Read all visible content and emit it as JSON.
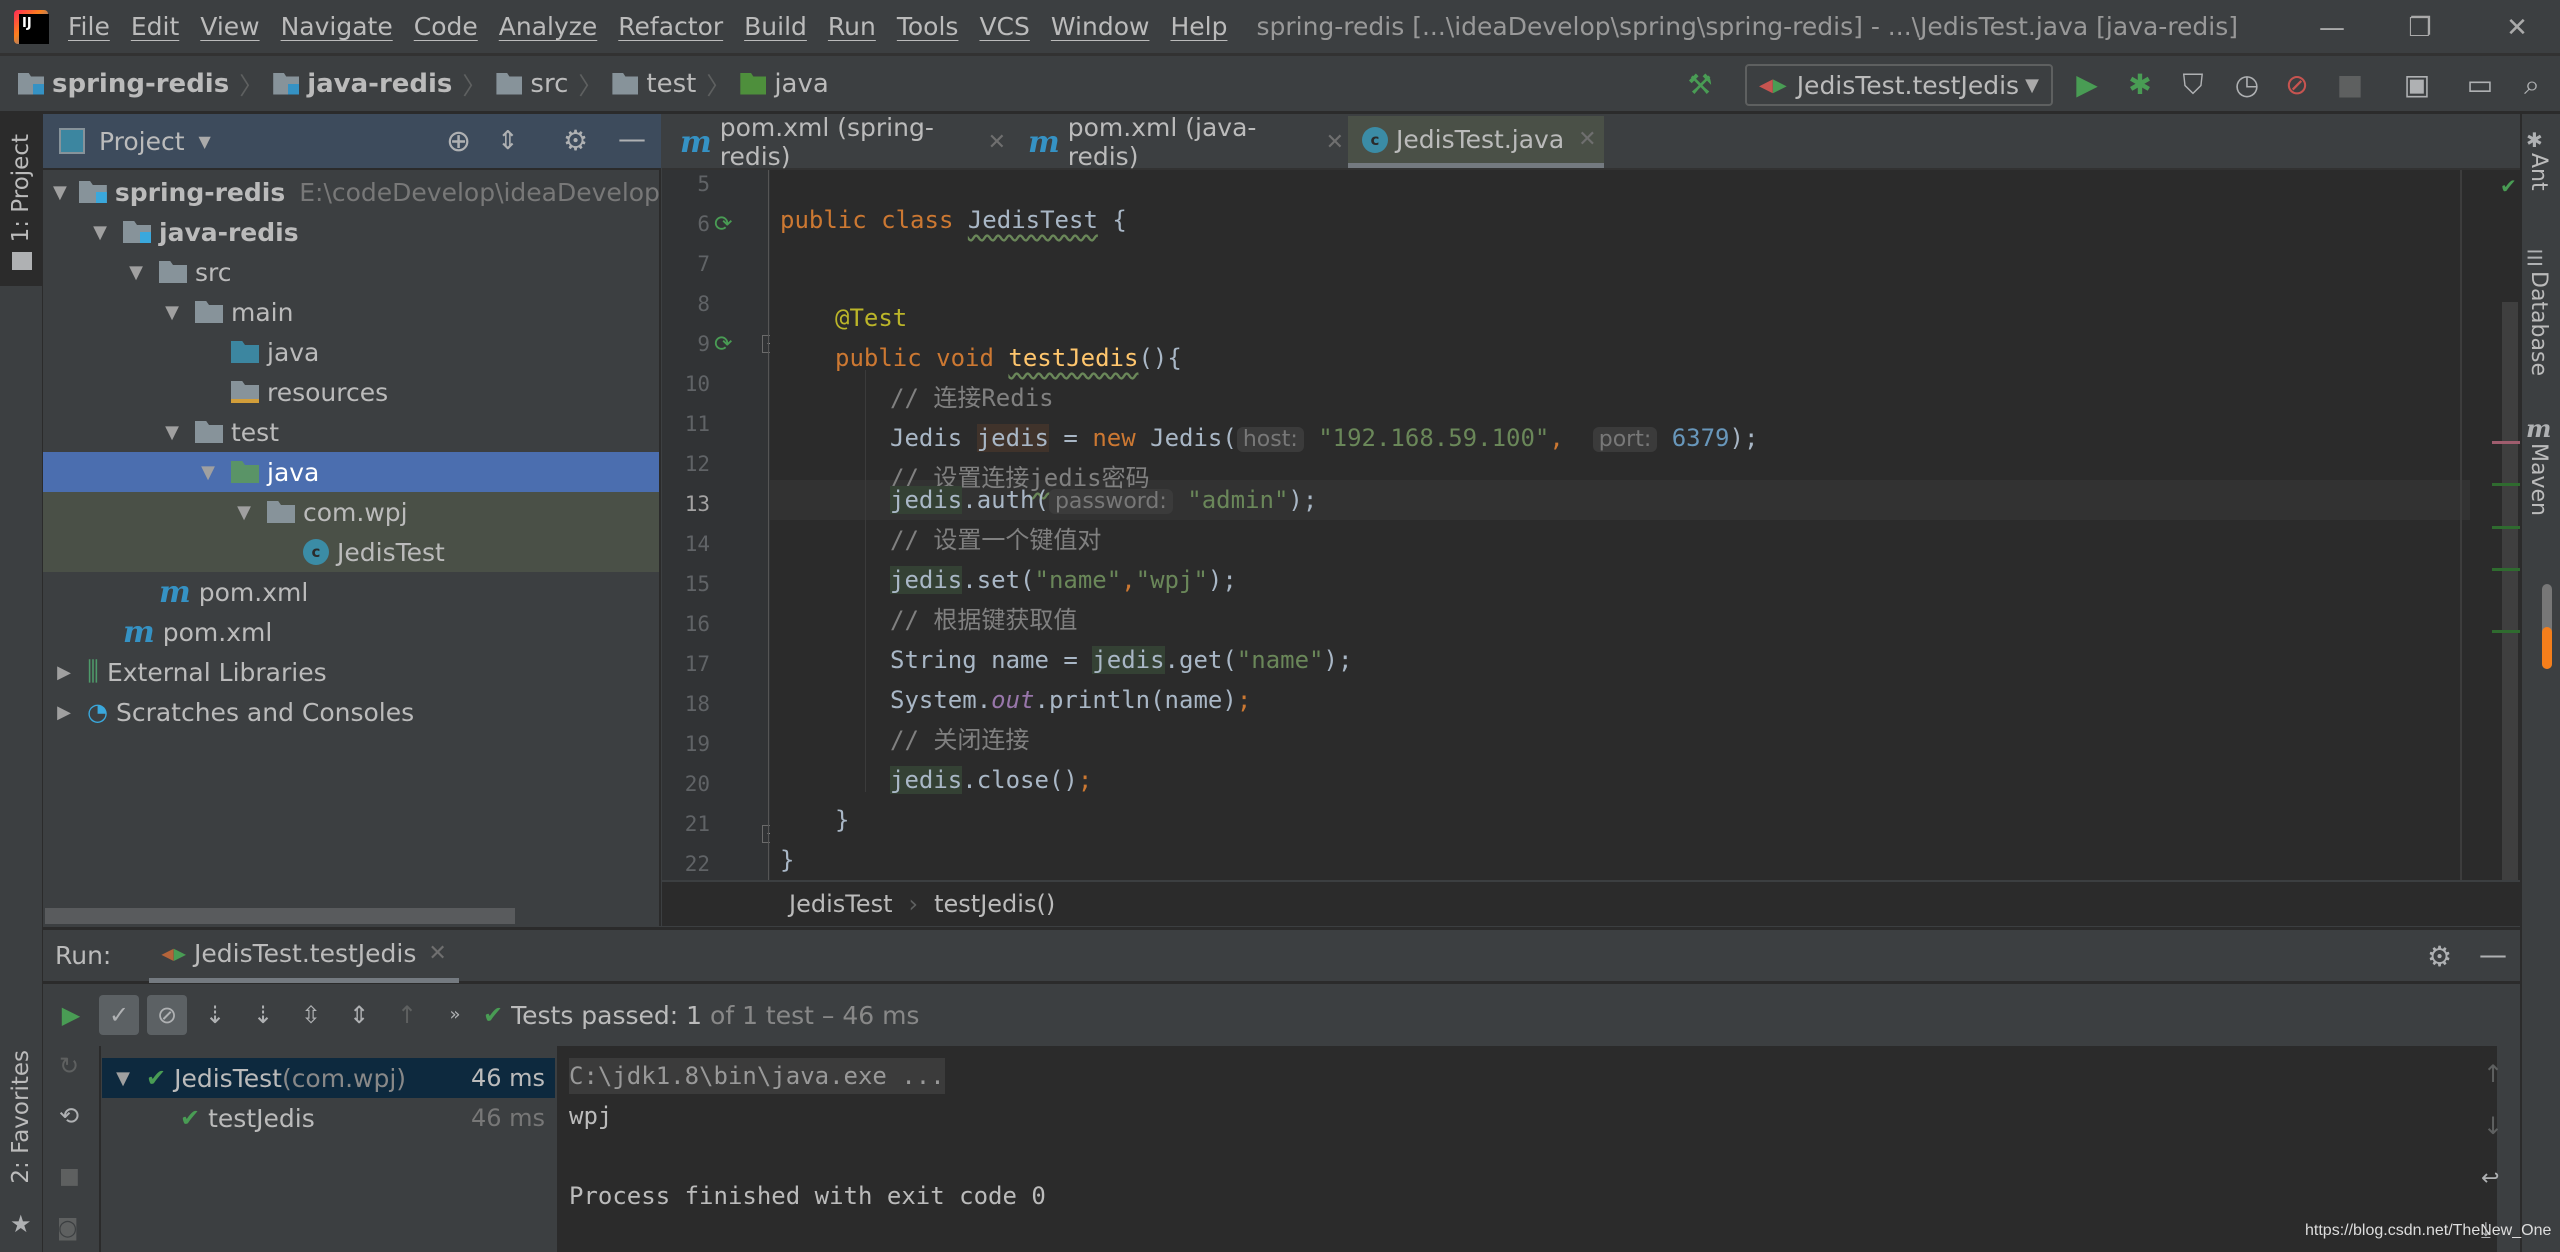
{
  "menu": [
    "File",
    "Edit",
    "View",
    "Navigate",
    "Code",
    "Analyze",
    "Refactor",
    "Build",
    "Run",
    "Tools",
    "VCS",
    "Window",
    "Help"
  ],
  "window_title": "spring-redis [...\\ideaDevelop\\spring\\spring-redis] - ...\\JedisTest.java [java-redis]",
  "window_controls": {
    "minimize": "—",
    "restore": "❐",
    "close": "✕"
  },
  "breadcrumb": [
    "spring-redis",
    "java-redis",
    "src",
    "test",
    "java"
  ],
  "run_config": "JedisTest.testJedis",
  "project_panel": {
    "title": "Project",
    "tree": [
      {
        "label": "spring-redis",
        "path": "E:\\codeDevelop\\ideaDevelop\\spr",
        "depth": 0,
        "expanded": true,
        "icon": "module-folder-icon",
        "bold": true
      },
      {
        "label": "java-redis",
        "depth": 1,
        "expanded": true,
        "icon": "module-folder-icon",
        "bold": true
      },
      {
        "label": "src",
        "depth": 2,
        "expanded": true,
        "icon": "folder-icon"
      },
      {
        "label": "main",
        "depth": 3,
        "expanded": true,
        "icon": "folder-icon"
      },
      {
        "label": "java",
        "depth": 4,
        "icon": "source-folder-icon"
      },
      {
        "label": "resources",
        "depth": 4,
        "icon": "resources-folder-icon"
      },
      {
        "label": "test",
        "depth": 3,
        "expanded": true,
        "icon": "folder-icon"
      },
      {
        "label": "java",
        "depth": 4,
        "expanded": true,
        "icon": "test-folder-icon",
        "selected": true
      },
      {
        "label": "com.wpj",
        "depth": 5,
        "expanded": true,
        "icon": "package-icon"
      },
      {
        "label": "JedisTest",
        "depth": 6,
        "icon": "test-class-icon"
      },
      {
        "label": "pom.xml",
        "depth": 2,
        "icon": "maven-icon"
      },
      {
        "label": "pom.xml",
        "depth": 1,
        "icon": "maven-icon"
      },
      {
        "label": "External Libraries",
        "depth": 0,
        "collapsed": true,
        "icon": "libraries-icon"
      },
      {
        "label": "Scratches and Consoles",
        "depth": 0,
        "collapsed": true,
        "icon": "scratches-icon"
      }
    ]
  },
  "left_strip": {
    "project": "1: Project",
    "favorites": "2: Favorites"
  },
  "right_strip": {
    "ant": "Ant",
    "database": "Database",
    "maven": "Maven"
  },
  "editor": {
    "tabs": [
      {
        "label": "pom.xml (spring-redis)",
        "icon": "maven-icon"
      },
      {
        "label": "pom.xml (java-redis)",
        "icon": "maven-icon"
      },
      {
        "label": "JedisTest.java",
        "icon": "test-class-icon",
        "active": true
      }
    ],
    "line_numbers": [
      "5",
      "6",
      "7",
      "8",
      "9",
      "10",
      "11",
      "12",
      "13",
      "14",
      "15",
      "16",
      "17",
      "18",
      "19",
      "20",
      "21",
      "22"
    ],
    "current_line": "13",
    "code": {
      "l6": {
        "kw": "public class ",
        "name": "JedisTest",
        " rest": " {"
      },
      "l8": "@Test",
      "l9": {
        "kw": "public void ",
        "fn": "testJedis",
        "rest": "(){"
      },
      "l10": "// 连接Redis",
      "l11": {
        "a": "Jedis ",
        "var": "jedis",
        "b": " = ",
        "kw": "new",
        "c": " Jedis(",
        "hint1": "host:",
        "str": "\"192.168.59.100\"",
        "comma": ",",
        "hint2": "port:",
        "num": "6379",
        "end": ");"
      },
      "l12": {
        "a": "// 设置连接",
        "b": "jedis",
        "c": "密码"
      },
      "l13": {
        "var": "jedis",
        "a": ".auth(",
        "hint": "password:",
        "str": "\"admin\"",
        "end": ");"
      },
      "l14": "// 设置一个键值对",
      "l15": {
        "var": "jedis",
        "a": ".set(",
        "s1": "\"name\"",
        "comma": ",",
        "s2": "\"wpj\"",
        "end": ");"
      },
      "l16": "// 根据键获取值",
      "l17": {
        "a": "String name = ",
        "var": "jedis",
        "b": ".get(",
        "str": "\"name\"",
        "end": ");"
      },
      "l18": {
        "a": "System.",
        "fld": "out",
        "b": ".println(name)",
        "end": ";"
      },
      "l19": "// 关闭连接",
      "l20": {
        "var": "jedis",
        "a": ".close()",
        "end": ";"
      },
      "l21": "}",
      "l22": "}"
    },
    "crumbs": [
      "JedisTest",
      "testJedis()"
    ]
  },
  "run_panel": {
    "label": "Run:",
    "tab": "JedisTest.testJedis",
    "status": {
      "prefix": "Tests passed: ",
      "count": "1",
      "suffix": " of 1 test – 46 ms"
    },
    "tests": [
      {
        "name": "JedisTest",
        "pkg": " (com.wpj)",
        "duration": "46 ms",
        "selected": true
      },
      {
        "name": "testJedis",
        "duration": "46 ms"
      }
    ],
    "console": [
      "C:\\jdk1.8\\bin\\java.exe ...",
      "wpj",
      "",
      "Process finished with exit code 0"
    ]
  },
  "watermark": "https://blog.csdn.net/TheNew_One",
  "colors": {
    "accent": "#4b6eaf",
    "pass": "#499c54",
    "editor_bg": "#2b2b2b",
    "panel_bg": "#3c3f41"
  }
}
